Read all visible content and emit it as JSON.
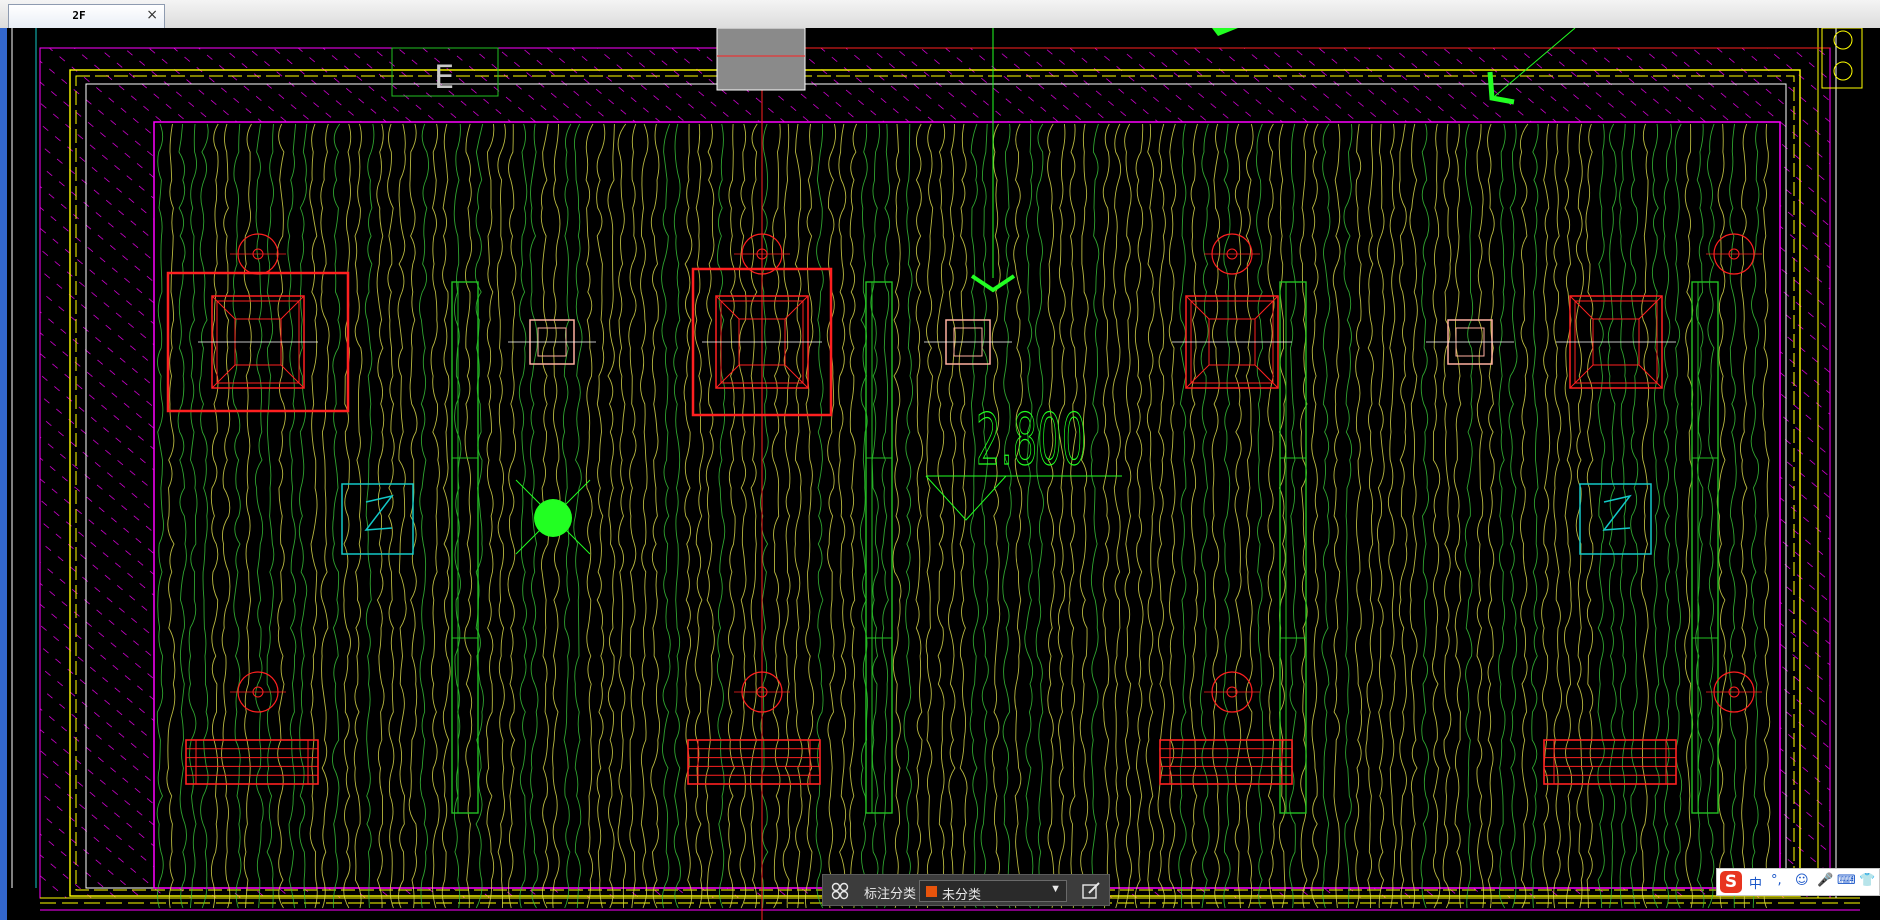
{
  "tab": {
    "label": "2F",
    "close_glyph": "×"
  },
  "drawing": {
    "elevation_text": "2.800",
    "room_letter": "E",
    "icons": [
      "ceiling-fixture-icon",
      "smoke-detector-icon",
      "lighting-panel-icon",
      "return-air-grille-icon",
      "ceiling-light-icon"
    ]
  },
  "annotation_bar": {
    "label": "标注分类",
    "selected": "未分类",
    "swatch_color": "#e8540c",
    "icons": [
      "grid-icon",
      "dropdown-arrow-icon",
      "edit-icon"
    ]
  },
  "ime_bar": {
    "logo": "S",
    "items": [
      "中",
      "°,",
      "☺",
      "🎤",
      "⌨",
      "👕"
    ]
  },
  "colors": {
    "background": "#000000",
    "hatch_magenta": "#ff00ff",
    "texture_yellow": "#d8d84a",
    "texture_green": "#37c037",
    "fixture_red": "#ff2020",
    "detector_green": "#22ff22",
    "panel_cyan": "#12c8c8"
  }
}
